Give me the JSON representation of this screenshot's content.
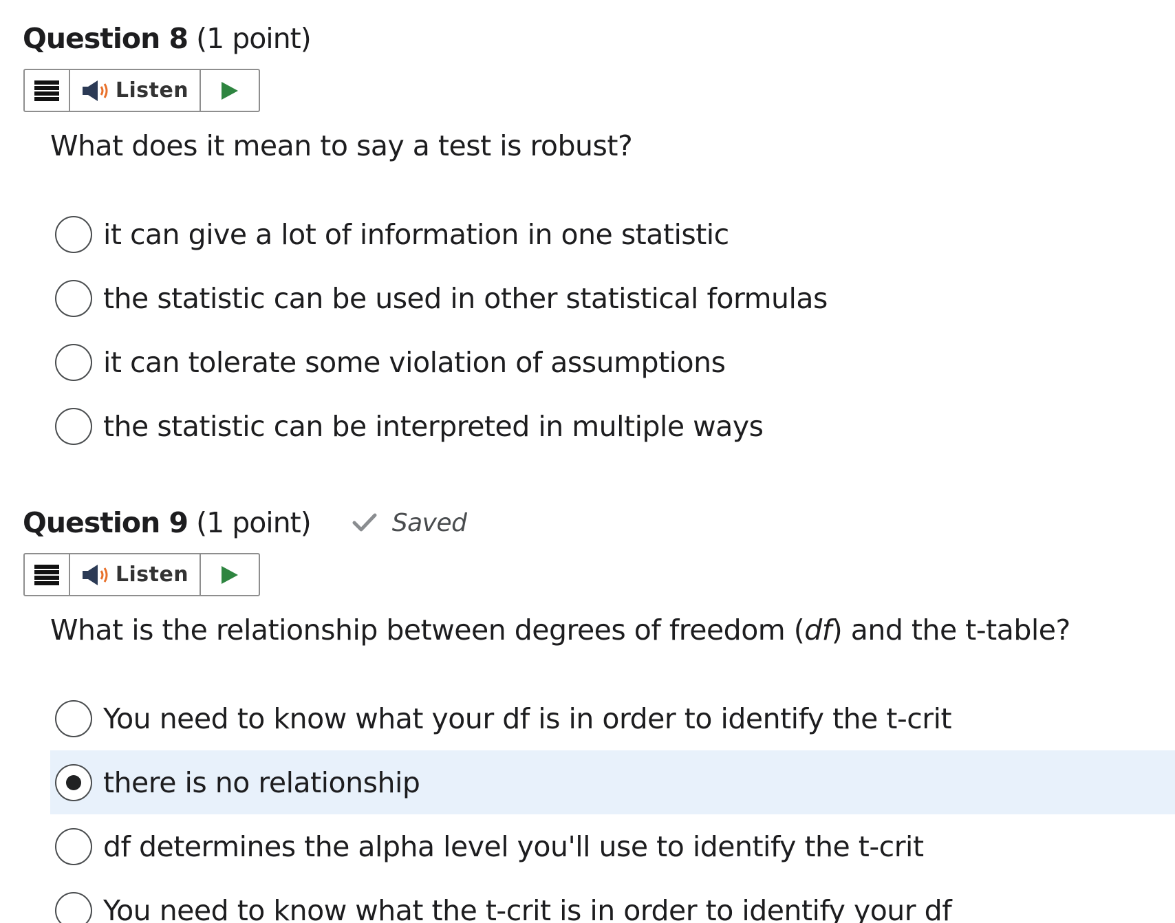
{
  "questions": [
    {
      "title": "Question 8",
      "points": "(1 point)",
      "saved": null,
      "listen_label": "Listen",
      "text": "What does it mean to say a test is robust?",
      "options": [
        {
          "label": "it can give a lot of information in one statistic",
          "selected": false
        },
        {
          "label": "the statistic can be used in other statistical formulas",
          "selected": false
        },
        {
          "label": "it can tolerate some violation of assumptions",
          "selected": false
        },
        {
          "label": "the statistic can be interpreted in multiple ways",
          "selected": false
        }
      ]
    },
    {
      "title": "Question 9",
      "points": "(1 point)",
      "saved": "Saved",
      "listen_label": "Listen",
      "text_before": "What is the relationship between degrees of freedom (",
      "text_italic": "df",
      "text_after": ") and the t-table?",
      "options": [
        {
          "label": "You need to know what your df is in order to identify the t-crit",
          "selected": false
        },
        {
          "label": "there is no relationship",
          "selected": true
        },
        {
          "label": "df determines the alpha level you'll use to identify the t-crit",
          "selected": false
        },
        {
          "label": "You need to know what the t-crit is in order to identify your df",
          "selected": false
        }
      ]
    }
  ],
  "colors": {
    "selected_bg": "#e8f1fb",
    "play_green": "#2e8540",
    "speaker_orange": "#e8702a",
    "saved_check": "#8a8d90"
  },
  "icons": {
    "menu": "hamburger-menu-icon",
    "speaker": "speaker-icon",
    "play": "play-icon",
    "saved": "checkmark-icon",
    "radio": "radio-button"
  }
}
